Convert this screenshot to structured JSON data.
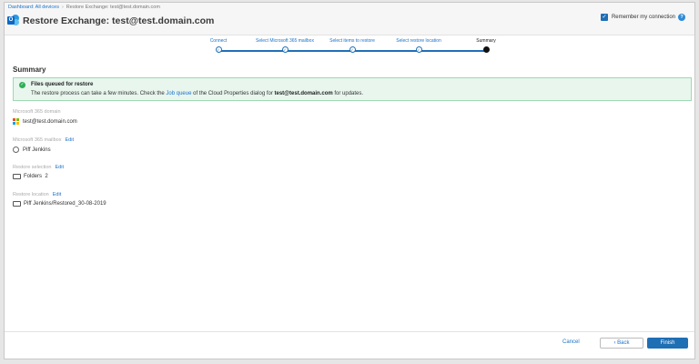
{
  "breadcrumb": {
    "items": [
      "Dashboard: All devices",
      "Restore Exchange: test@test.domain.com"
    ]
  },
  "header": {
    "title": "Restore Exchange: test@test.domain.com",
    "remember_label": "Remember my connection",
    "remember_checked": true
  },
  "stepper": {
    "steps": [
      "Connect",
      "Select Microsoft 365 mailbox",
      "Select items to restore",
      "Select restore location",
      "Summary"
    ],
    "current_index": 4
  },
  "summary": {
    "title": "Summary",
    "banner": {
      "title": "Files queued for restore",
      "msg_before": "The restore process can take a few minutes. Check the ",
      "link": "Job queue",
      "msg_middle": " of the Cloud Properties dialog for ",
      "email": "test@test.domain.com",
      "msg_after": " for updates."
    },
    "domain": {
      "label": "Microsoft 365 domain",
      "value": "test@test.domain.com"
    },
    "mailbox": {
      "label": "Microsoft 365 mailbox",
      "edit": "Edit",
      "value": "Piff Jenkins"
    },
    "selection": {
      "label": "Restore selection",
      "edit": "Edit",
      "value": "Folders  2"
    },
    "location": {
      "label": "Restore location",
      "edit": "Edit",
      "value": "Piff Jenkins/Restored_30-08-2019"
    }
  },
  "footer": {
    "cancel": "Cancel",
    "back": "Back",
    "finish": "Finish"
  },
  "colors": {
    "accent": "#1f6fb5",
    "success": "#2eae58",
    "banner_bg": "#e8f6ee"
  }
}
